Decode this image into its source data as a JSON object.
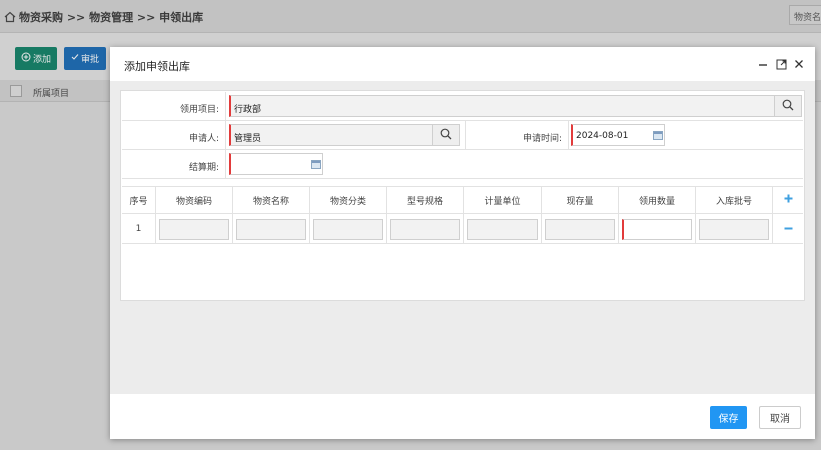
{
  "breadcrumb": {
    "text": "物资采购 >> 物资管理 >> 申领出库"
  },
  "top_search": {
    "placeholder": "物资名称"
  },
  "toolbar": {
    "add_label": "添加",
    "approve_label": "审批"
  },
  "list": {
    "column_project": "所属项目"
  },
  "modal": {
    "title": "添加申领出库",
    "fields": {
      "project_label": "领用项目:",
      "project_value": "行政部",
      "applicant_label": "申请人:",
      "applicant_value": "管理员",
      "apply_time_label": "申请时间:",
      "apply_time_value": "2024-08-01",
      "settle_label": "结算期:",
      "settle_value": ""
    },
    "grid": {
      "headers": [
        "序号",
        "物资编码",
        "物资名称",
        "物资分类",
        "型号规格",
        "计量单位",
        "现存量",
        "领用数量",
        "入库批号"
      ],
      "row_index": "1"
    },
    "save_label": "保存",
    "cancel_label": "取消"
  },
  "colors": {
    "accent": "#2196f3",
    "required": "#e23b3b",
    "add_button": "#177a63",
    "approve_button": "#1e66a8"
  },
  "icons": [
    "home-icon",
    "plus-circle-icon",
    "check-icon",
    "search-icon",
    "calendar-icon",
    "minimize-icon",
    "maximize-icon",
    "close-icon",
    "add-row-icon",
    "remove-row-icon"
  ]
}
